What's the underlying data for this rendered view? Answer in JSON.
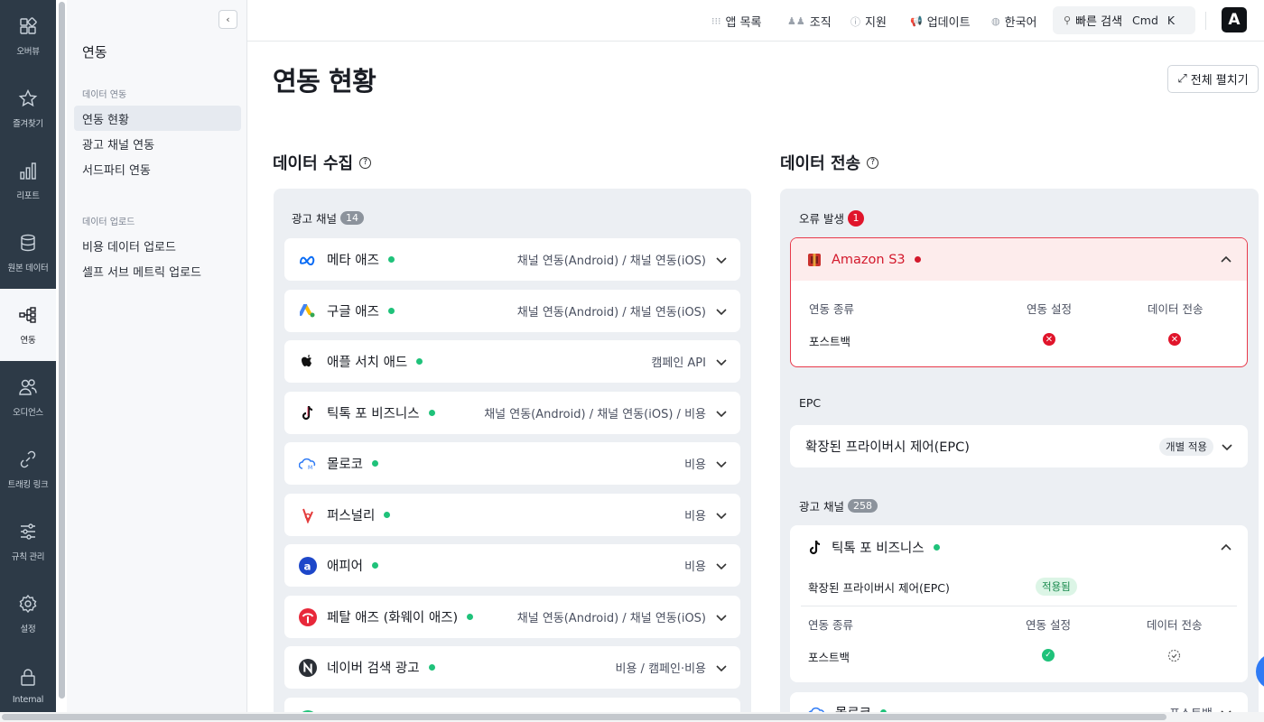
{
  "rail": {
    "items": [
      {
        "label": "오버뷰",
        "icon": "grid-icon"
      },
      {
        "label": "즐겨찾기",
        "icon": "star-icon"
      },
      {
        "label": "리포트",
        "icon": "bar-chart-icon"
      },
      {
        "label": "원본 데이터",
        "icon": "database-icon"
      },
      {
        "label": "연동",
        "icon": "integration-icon"
      },
      {
        "label": "오디언스",
        "icon": "audience-icon"
      },
      {
        "label": "트래킹 링크",
        "icon": "link-icon"
      },
      {
        "label": "규칙 관리",
        "icon": "sliders-icon"
      },
      {
        "label": "설정",
        "icon": "gear-icon"
      },
      {
        "label": "Internal",
        "icon": "lock-icon"
      }
    ],
    "active_index": 4
  },
  "subnav": {
    "title": "연동",
    "group1": "데이터 연동",
    "group1_items": [
      "연동 현황",
      "광고 채널 연동",
      "서드파티 연동"
    ],
    "group2": "데이터 업로드",
    "group2_items": [
      "비용 데이터 업로드",
      "셀프 서브 메트릭 업로드"
    ]
  },
  "topbar": {
    "apps": "앱 목록",
    "org": "조직",
    "support": "지원",
    "updates": "업데이트",
    "language": "한국어",
    "search": "빠른 검색",
    "shortcut_cmd": "Cmd",
    "shortcut_key": "K",
    "logo": "A"
  },
  "main": {
    "title": "연동 현황",
    "expand_all": "전체 펼치기",
    "collect_title": "데이터 수집",
    "send_title": "데이터 전송"
  },
  "collect": {
    "group_label": "광고 채널",
    "count": "14",
    "channels": [
      {
        "name": "메타 애즈",
        "detail": "채널 연동(Android) / 채널 연동(iOS)",
        "icon": "meta-icon"
      },
      {
        "name": "구글 애즈",
        "detail": "채널 연동(Android) / 채널 연동(iOS)",
        "icon": "google-ads-icon"
      },
      {
        "name": "애플 서치 애드",
        "detail": "캠페인 API",
        "icon": "apple-icon"
      },
      {
        "name": "틱톡 포 비즈니스",
        "detail": "채널 연동(Android) / 채널 연동(iOS) / 비용",
        "icon": "tiktok-icon"
      },
      {
        "name": "몰로코",
        "detail": "비용",
        "icon": "moloco-icon"
      },
      {
        "name": "퍼스널리",
        "detail": "비용",
        "icon": "personaly-icon"
      },
      {
        "name": "애피어",
        "detail": "비용",
        "icon": "appier-icon"
      },
      {
        "name": "페탈 애즈 (화웨이 애즈)",
        "detail": "채널 연동(Android) / 채널 연동(iOS)",
        "icon": "petal-icon"
      },
      {
        "name": "네이버 검색 광고",
        "detail": "비용 / 캠페인·비용",
        "icon": "naver-icon"
      }
    ]
  },
  "send": {
    "error_label": "오류 발생",
    "error_count": "1",
    "error_card": {
      "name": "Amazon S3",
      "col1": "연동 종류",
      "col2": "연동 설정",
      "col3": "데이터 전송",
      "row_label": "포스트백"
    },
    "epc_label": "EPC",
    "epc_card": {
      "name": "확장된 프라이버시 제어(EPC)",
      "pill": "개별 적용"
    },
    "channels_label": "광고 채널",
    "channels_count": "258",
    "tiktok_card": {
      "name": "틱톡 포 비즈니스",
      "epc_label": "확장된 프라이버시 제어(EPC)",
      "epc_pill": "적용됨",
      "col1": "연동 종류",
      "col2": "연동 설정",
      "col3": "데이터 전송",
      "row_label": "포스트백"
    },
    "next_card": {
      "name": "몰로코",
      "detail": "포스트백"
    }
  }
}
